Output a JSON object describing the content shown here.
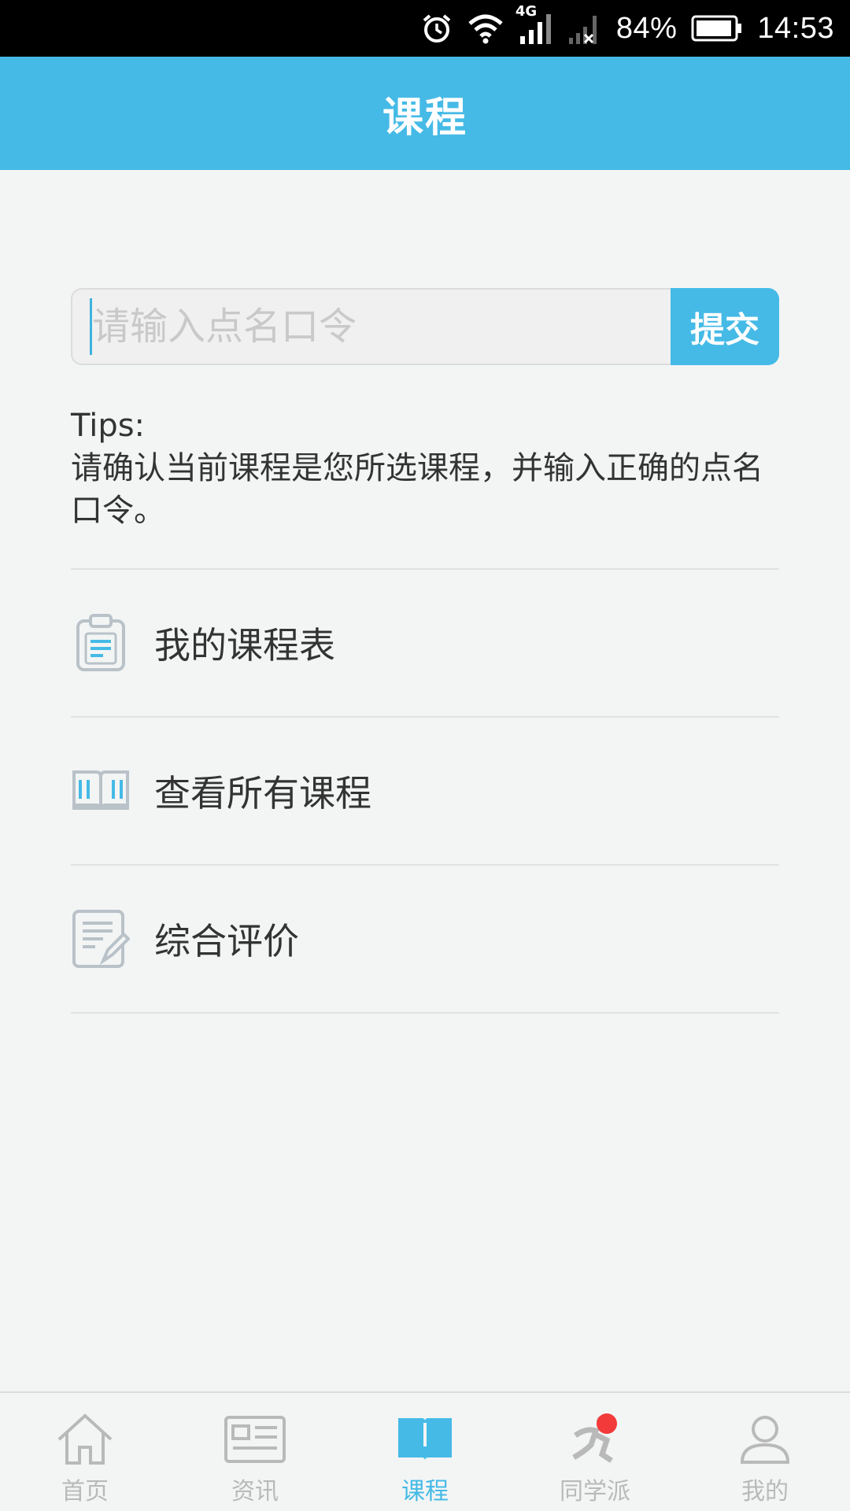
{
  "status_bar": {
    "network": "4G",
    "battery": "84%",
    "time": "14:53"
  },
  "header": {
    "title": "课程"
  },
  "roll_call": {
    "placeholder": "请输入点名口令",
    "value": "",
    "submit_label": "提交"
  },
  "tips": {
    "heading": "Tips:",
    "text": "请确认当前课程是您所选课程，并输入正确的点名口令。"
  },
  "menu": {
    "items": [
      {
        "label": "我的课程表",
        "icon": "clipboard-icon"
      },
      {
        "label": "查看所有课程",
        "icon": "open-book-icon"
      },
      {
        "label": "综合评价",
        "icon": "document-edit-icon"
      }
    ]
  },
  "bottom_nav": {
    "items": [
      {
        "label": "首页",
        "icon": "home-icon"
      },
      {
        "label": "资讯",
        "icon": "news-icon"
      },
      {
        "label": "课程",
        "icon": "book-icon",
        "active": true
      },
      {
        "label": "同学派",
        "icon": "runner-icon",
        "badge": true
      },
      {
        "label": "我的",
        "icon": "person-icon"
      }
    ]
  },
  "colors": {
    "accent": "#45bae6",
    "background": "#f3f5f5",
    "badge": "#f23a3a"
  }
}
